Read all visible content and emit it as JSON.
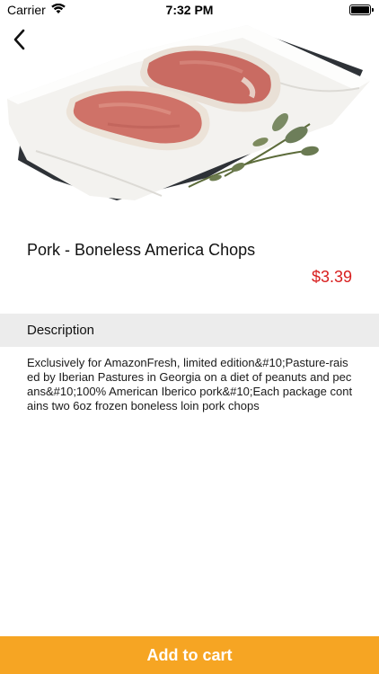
{
  "status_bar": {
    "carrier": "Carrier",
    "time": "7:32 PM"
  },
  "nav": {
    "back_icon": "chevron-left-icon"
  },
  "product": {
    "title": "Pork - Boneless America Chops",
    "price": "$3.39",
    "image_alt": "pork chops on parchment with thyme"
  },
  "description": {
    "header": "Description",
    "text": "Exclusively for AmazonFresh, limited edition&#10;Pasture-raised by Iberian Pastures in Georgia on a diet of peanuts and pecans&#10;100% American Iberico pork&#10;Each package contains two 6oz frozen boneless loin pork chops"
  },
  "actions": {
    "add_to_cart": "Add to cart"
  },
  "colors": {
    "accent": "#f6a523",
    "price": "#d81e1e",
    "section_header_bg": "#ececec"
  }
}
